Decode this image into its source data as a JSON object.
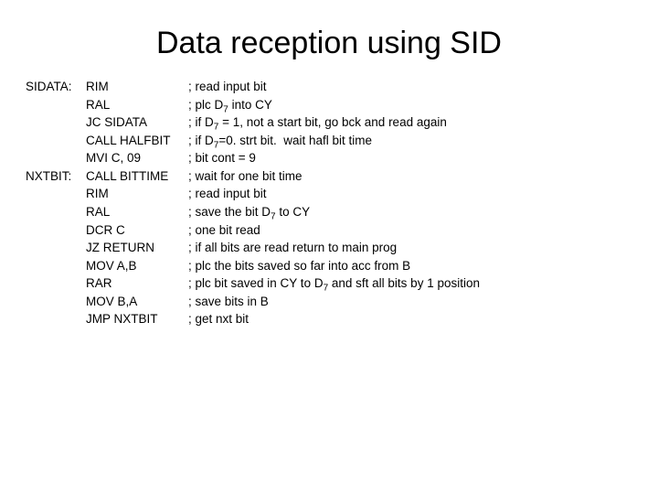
{
  "title": "Data reception using SID",
  "lines": [
    {
      "label": "SIDATA:",
      "instr": "RIM",
      "comment": "; read input bit"
    },
    {
      "label": "",
      "instr": "RAL",
      "comment": "; plc D<sub>7</sub> into CY"
    },
    {
      "label": "",
      "instr": "JC SIDATA",
      "comment": "; if D<sub>7</sub> = 1, not a start bit, go bck and read again"
    },
    {
      "label": "",
      "instr": "CALL HALFBIT",
      "comment": "; if D<sub>7</sub>=0. strt bit.  wait hafl bit time"
    },
    {
      "label": "",
      "instr": "MVI C, 09",
      "comment": "; bit cont = 9"
    },
    {
      "label": "NXTBIT:",
      "instr": "CALL BITTIME",
      "comment": "; wait for one bit time"
    },
    {
      "label": "",
      "instr": "RIM",
      "comment": "; read input bit"
    },
    {
      "label": "",
      "instr": "RAL",
      "comment": "; save the bit D<sub>7</sub> to CY"
    },
    {
      "label": "",
      "instr": "DCR C",
      "comment": "; one bit read"
    },
    {
      "label": "",
      "instr": "JZ RETURN",
      "comment": "; if all bits are read return to main prog"
    },
    {
      "label": "",
      "instr": "MOV A,B",
      "comment": "; plc the bits saved so far into acc from B"
    },
    {
      "label": "",
      "instr": "RAR",
      "comment": "; plc bit saved in CY to D<sub>7</sub> and sft all bits by 1 position"
    },
    {
      "label": "",
      "instr": "MOV B,A",
      "comment": "; save bits in B"
    },
    {
      "label": "",
      "instr": "JMP NXTBIT",
      "comment": "; get nxt bit"
    }
  ]
}
